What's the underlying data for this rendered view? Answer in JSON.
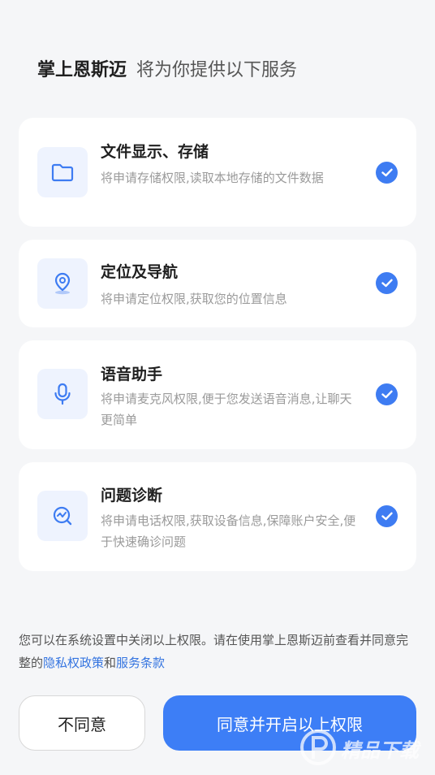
{
  "header": {
    "brand": "掌上恩斯迈",
    "subtitle": "将为你提供以下服务"
  },
  "services": [
    {
      "title": "文件显示、存储",
      "description": "将申请存储权限,读取本地存储的文件数据",
      "icon": "folder-icon",
      "checked": true
    },
    {
      "title": "定位及导航",
      "description": "将申请定位权限,获取您的位置信息",
      "icon": "location-pin-icon",
      "checked": true
    },
    {
      "title": "语音助手",
      "description": "将申请麦克风权限,便于您发送语音消息,让聊天更简单",
      "icon": "microphone-icon",
      "checked": true
    },
    {
      "title": "问题诊断",
      "description": "将申请电话权限,获取设备信息,保障账户安全,便于快速确诊问题",
      "icon": "diagnostics-icon",
      "checked": true
    }
  ],
  "notice": {
    "text": "您可以在系统设置中关闭以上权限。请在使用掌上恩斯迈前查看并同意完整的",
    "privacy_link": "隐私权政策",
    "joiner": "和",
    "terms_link": "服务条款"
  },
  "buttons": {
    "decline": "不同意",
    "accept": "同意并开启以上权限"
  },
  "colors": {
    "accent": "#3d7ef6",
    "link": "#3474e0",
    "icon_bg": "#eef3fe",
    "page_bg": "#f5f6f8"
  },
  "watermark": {
    "text": "精品下载"
  }
}
